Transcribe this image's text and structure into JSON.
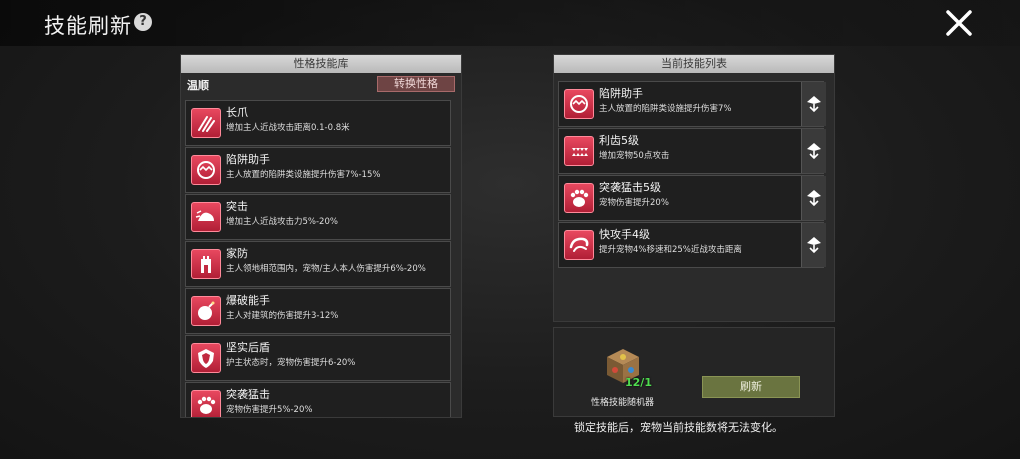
{
  "header": {
    "title": "技能刷新",
    "help_icon": "question-icon",
    "close_icon": "close-icon"
  },
  "library": {
    "title": "性格技能库",
    "temperament": "温顺",
    "switch_label": "转换性格",
    "skills": [
      {
        "name": "长爪",
        "desc": "增加主人近战攻击距离0.1-0.8米",
        "icon": "claw-icon"
      },
      {
        "name": "陷阱助手",
        "desc": "主人放置的陷阱类设施提升伤害7%-15%",
        "icon": "trap-icon"
      },
      {
        "name": "突击",
        "desc": "增加主人近战攻击力5%-20%",
        "icon": "assault-icon"
      },
      {
        "name": "家防",
        "desc": "主人领地相范围内，宠物/主人本人伤害提升6%-20%",
        "icon": "tower-icon"
      },
      {
        "name": "爆破能手",
        "desc": "主人对建筑的伤害提升3-12%",
        "icon": "bomb-icon"
      },
      {
        "name": "坚实后盾",
        "desc": "护主状态时，宠物伤害提升6-20%",
        "icon": "shield-icon"
      },
      {
        "name": "突袭猛击",
        "desc": "宠物伤害提升5%-20%",
        "icon": "paw-icon"
      }
    ]
  },
  "current": {
    "title": "当前技能列表",
    "skills": [
      {
        "name": "陷阱助手",
        "desc": "主人放置的陷阱类设施提升伤害7%",
        "icon": "trap-icon"
      },
      {
        "name": "利齿5级",
        "desc": "增加宠物50点攻击",
        "icon": "fang-icon"
      },
      {
        "name": "突袭猛击5级",
        "desc": "宠物伤害提升20%",
        "icon": "paw-icon"
      },
      {
        "name": "快攻手4级",
        "desc": "提升宠物4%移速和25%近战攻击距离",
        "icon": "swipe-icon"
      }
    ]
  },
  "randomizer": {
    "item_label": "性格技能随机器",
    "count": "12/1",
    "refresh_label": "刷新"
  },
  "note": "锁定技能后，宠物当前技能数将无法变化。"
}
